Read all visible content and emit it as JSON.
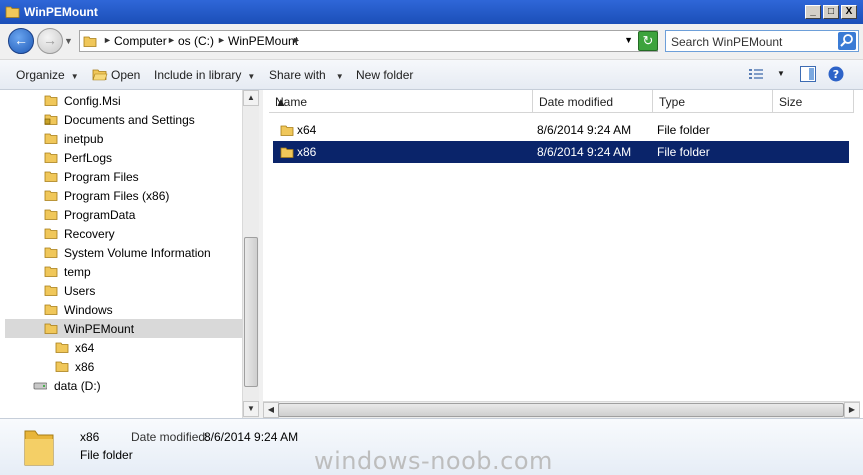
{
  "window": {
    "title": "WinPEMount",
    "controls": {
      "minimize": "_",
      "maximize": "□",
      "close": "X"
    }
  },
  "address": {
    "breadcrumbs": [
      "Computer",
      "os (C:)",
      "WinPEMount"
    ],
    "search_placeholder": "Search WinPEMount"
  },
  "toolbar": {
    "organize": "Organize",
    "open": "Open",
    "include_in_library": "Include in library",
    "share_with": "Share with",
    "new_folder": "New folder"
  },
  "navigation": {
    "items": [
      {
        "label": "Config.Msi"
      },
      {
        "label": "Documents and Settings",
        "locked": true
      },
      {
        "label": "inetpub"
      },
      {
        "label": "PerfLogs"
      },
      {
        "label": "Program Files"
      },
      {
        "label": "Program Files (x86)"
      },
      {
        "label": "ProgramData"
      },
      {
        "label": "Recovery"
      },
      {
        "label": "System Volume Information"
      },
      {
        "label": "temp"
      },
      {
        "label": "Users"
      },
      {
        "label": "Windows"
      },
      {
        "label": "WinPEMount",
        "selected": true
      },
      {
        "label": "x64",
        "child": true
      },
      {
        "label": "x86",
        "child": true
      },
      {
        "label": "data (D:)",
        "drive": true
      }
    ]
  },
  "filelist": {
    "columns": [
      "Name",
      "Date modified",
      "Type",
      "Size"
    ],
    "rows": [
      {
        "name": "x64",
        "date": "8/6/2014 9:24 AM",
        "type": "File folder",
        "selected": false
      },
      {
        "name": "x86",
        "date": "8/6/2014 9:24 AM",
        "type": "File folder",
        "selected": true
      }
    ]
  },
  "details": {
    "name": "x86",
    "date_label": "Date modified:",
    "date_value": "8/6/2014 9:24 AM",
    "type": "File folder"
  },
  "watermark": "windows-noob.com",
  "colors": {
    "titlebar": "#1b4fb8",
    "selection": "#0a246a",
    "folder": "#e8b53a"
  }
}
